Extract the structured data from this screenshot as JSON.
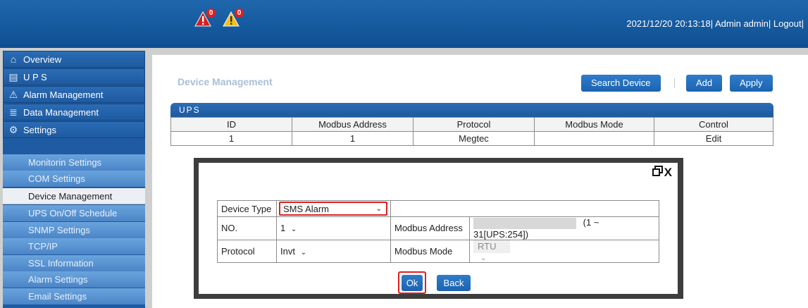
{
  "header": {
    "alarm_critical_count": "0",
    "alarm_warning_count": "0",
    "datetime": "2021/12/20 20:13:18|",
    "user": "Admin admin|",
    "logout": "Logout|"
  },
  "sidebar": {
    "items": [
      {
        "label": "Overview",
        "icon": "home-icon"
      },
      {
        "label": "U P S",
        "icon": "ups-icon"
      },
      {
        "label": "Alarm Management",
        "icon": "warning-icon"
      },
      {
        "label": "Data Management",
        "icon": "database-icon"
      },
      {
        "label": "Settings",
        "icon": "gear-icon"
      }
    ],
    "settings_children": [
      "Monitorin Settings",
      "COM Settings",
      "Device Management",
      "UPS On/Off Schedule",
      "SNMP Settings",
      "TCP/IP",
      "SSL Information",
      "Alarm Settings",
      "Email Settings"
    ],
    "active_child": "Device Management"
  },
  "main": {
    "title": "Device Management",
    "search_button": "Search Device",
    "add_button": "Add",
    "apply_button": "Apply",
    "table": {
      "caption": "UPS",
      "columns": [
        "ID",
        "Modbus Address",
        "Protocol",
        "Modbus Mode",
        "Control"
      ],
      "rows": [
        [
          "1",
          "1",
          "Megtec",
          "",
          "Edit"
        ]
      ]
    }
  },
  "modal": {
    "device_type_label": "Device Type",
    "device_type_value": "SMS Alarm",
    "no_label": "NO.",
    "no_value": "1",
    "modbus_address_label": "Modbus Address",
    "modbus_address_range": "(1 ~ 31[UPS:254])",
    "protocol_label": "Protocol",
    "protocol_value": "Invt",
    "modbus_mode_label": "Modbus Mode",
    "modbus_mode_value": "RTU",
    "ok_button": "Ok",
    "back_button": "Back",
    "close_glyph": "X"
  },
  "colors": {
    "header_blue": "#1a5fa8",
    "sidebar_blue": "#1e5ba3",
    "button_blue": "#1f6fc1",
    "highlight_red": "#e0201e",
    "alarm_yellow": "#f2c21b"
  }
}
